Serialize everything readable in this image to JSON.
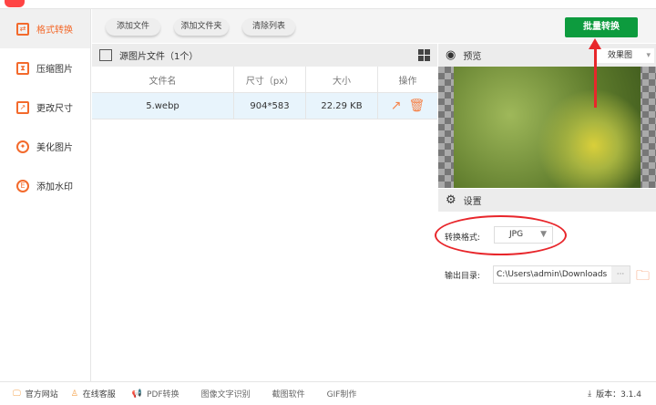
{
  "sidebar": {
    "items": [
      {
        "label": "格式转换",
        "icon": "convert-icon"
      },
      {
        "label": "压缩图片",
        "icon": "compress-icon"
      },
      {
        "label": "更改尺寸",
        "icon": "resize-icon"
      },
      {
        "label": "美化图片",
        "icon": "beautify-icon"
      },
      {
        "label": "添加水印",
        "icon": "watermark-icon"
      }
    ]
  },
  "toolbar": {
    "add_file": "添加文件",
    "add_folder": "添加文件夹",
    "clear_list": "清除列表",
    "batch_convert": "批量转换"
  },
  "list": {
    "title": "源图片文件（1个）",
    "columns": [
      "文件名",
      "尺寸（px）",
      "大小",
      "操作"
    ],
    "rows": [
      {
        "name": "5.webp",
        "dimensions": "904*583",
        "size": "22.29 KB"
      }
    ]
  },
  "preview": {
    "title": "预览",
    "mode": "效果图"
  },
  "settings": {
    "title": "设置",
    "format_label": "转换格式:",
    "format_value": "JPG",
    "output_label": "输出目录:",
    "output_value": "C:\\Users\\admin\\Downloads",
    "browse": "···"
  },
  "footer": {
    "website": "官方网站",
    "support": "在线客服",
    "pdf": "PDF转换",
    "ocr": "图像文字识别",
    "screenshot": "截图软件",
    "gif": "GIF制作",
    "version": "版本：3.1.4"
  },
  "colors": {
    "accent": "#f36a2c",
    "primary": "#0d9b3e",
    "annotation": "#e8262b"
  }
}
